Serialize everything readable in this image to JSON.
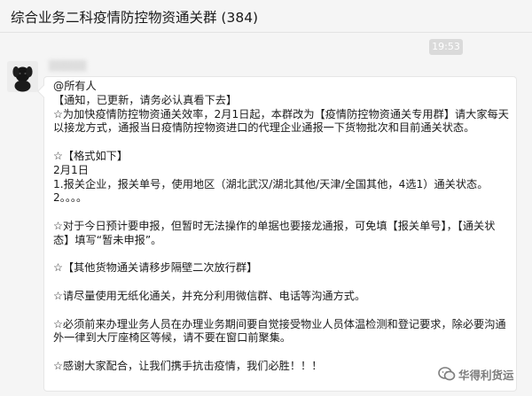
{
  "window": {
    "title": "综合业务二科疫情防控物资通关群 (384)"
  },
  "chat": {
    "timestamp": "19:53",
    "sender_name": "▒▒▒▒▒",
    "message_lines": [
      "@所有人",
      "【通知，已更新，请务必认真看下去】",
      "☆为加快疫情防控物资通关效率，2月1日起，本群改为【疫情防控物资通关专用群】请大家每天",
      "以接龙方式，通报当日疫情防控物资进口的代理企业通报一下货物批次和目前通关状态。",
      "",
      "☆【格式如下】",
      "2月1日",
      "1.报关企业，报关单号，使用地区（湖北武汉/湖北其他/天津/全国其他，4选1）通关状态。",
      "2。。。。",
      "",
      "☆对于今日预计要申报，但暂时无法操作的单据也要接龙通报，可免填【报关单号】，【通关状",
      "态】填写“暂未申报”。",
      "",
      "☆【其他货物通关请移步隔壁二次放行群】",
      "",
      "☆请尽量使用无纸化通关，并充分利用微信群、电话等沟通方式。",
      "",
      "☆必须前来办理业务人员在办理业务期间要自觉接受物业人员体温检测和登记要求，除必要沟通",
      "外一律到大厅座椅区等候，请不要在窗口前聚集。",
      "",
      "☆感谢大家配合，让我们携手抗击疫情，我们必胜！！！"
    ]
  },
  "watermark": {
    "text": "华得利货运",
    "icon": "wechat-channel-icon"
  }
}
